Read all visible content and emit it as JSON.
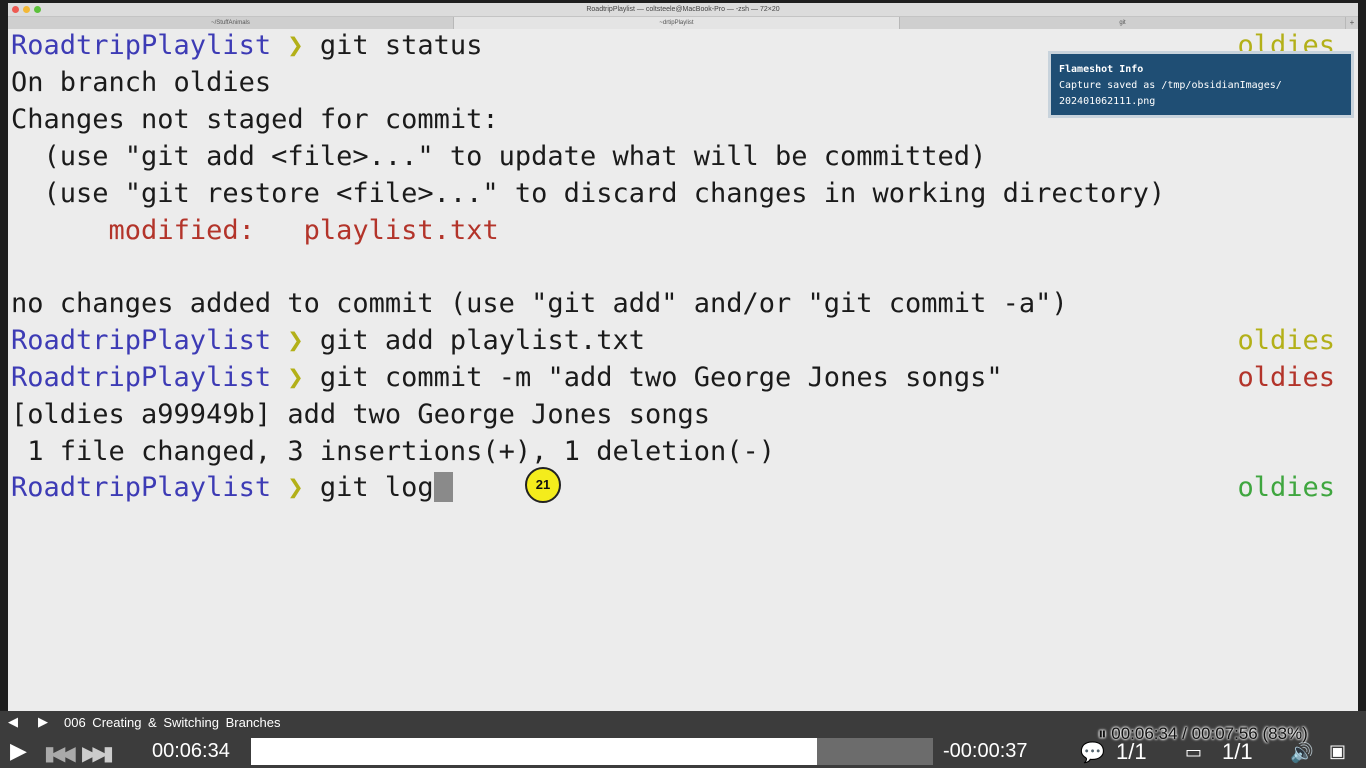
{
  "window": {
    "title": "RoadtripPlaylist — coltsteele@MacBook-Pro — -zsh — 72×20",
    "tabs": [
      "~/StuffAnimals",
      "~drtipPlaylist",
      "git"
    ]
  },
  "terminal": {
    "prompt_name": "RoadtripPlaylist",
    "prompt_chevron": "❯",
    "lines": [
      {
        "cmd": "git status",
        "branch": "oldies",
        "branch_color": "#b3b018"
      },
      {
        "text": "On branch oldies"
      },
      {
        "text": "Changes not staged for commit:"
      },
      {
        "text": "  (use \"git add <file>...\" to update what will be committed)"
      },
      {
        "text": "  (use \"git restore <file>...\" to discard changes in working directory)"
      },
      {
        "label": "modified:",
        "file": "playlist.txt"
      },
      {
        "text": "no changes added to commit (use \"git add\" and/or \"git commit -a\")"
      },
      {
        "cmd": "git add playlist.txt",
        "branch": "oldies",
        "branch_color": "#b3b018"
      },
      {
        "cmd": "git commit -m \"add two George Jones songs\"",
        "branch": "oldies",
        "branch_color": "#b3342a"
      },
      {
        "text": "[oldies a99949b] add two George Jones songs"
      },
      {
        "text": " 1 file changed, 3 insertions(+), 1 deletion(-)"
      },
      {
        "cmd": "git log",
        "branch": "oldies",
        "branch_color": "#3fa63f"
      }
    ],
    "step_badge": "21"
  },
  "notification": {
    "title": "Flameshot Info",
    "line1": "Capture saved as /tmp/obsidianImages/",
    "line2": "202401062111.png"
  },
  "player": {
    "video_title": "006 Creating & Switching Branches",
    "elapsed": "00:06:34",
    "remaining": "-00:00:37",
    "progress_fraction": 0.83,
    "osd": "00:06:34 / 00:07:56 (83%)",
    "chapters": "1/1",
    "subtitles": "1/1"
  }
}
